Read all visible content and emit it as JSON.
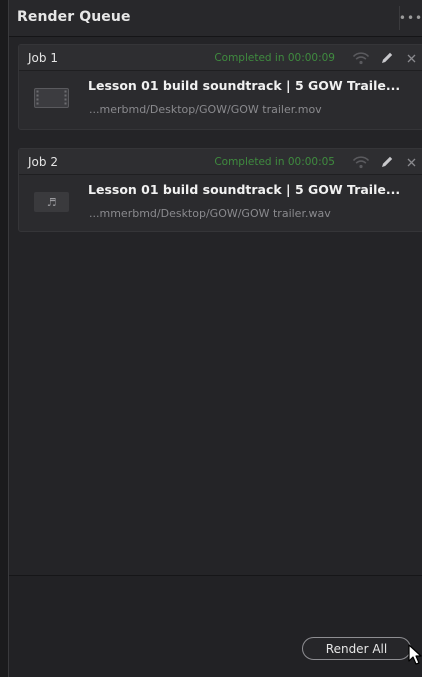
{
  "panel": {
    "title": "Render Queue",
    "more_icon": "more-horizontal-icon"
  },
  "jobs": [
    {
      "name": "Job 1",
      "status": "Completed in 00:00:09",
      "title": "Lesson 01 build soundtrack | 5 GOW Traile...",
      "path": "...merbmd/Desktop/GOW/GOW trailer.mov",
      "thumbnail": "video-file-icon"
    },
    {
      "name": "Job 2",
      "status": "Completed in 00:00:05",
      "title": "Lesson 01 build soundtrack | 5 GOW Traile...",
      "path": "...mmerbmd/Desktop/GOW/GOW trailer.wav",
      "thumbnail": "audio-file-icon"
    }
  ],
  "footer": {
    "render_all_label": "Render All"
  },
  "colors": {
    "status_green": "#3f8b3f",
    "panel_bg": "#242427",
    "job_bg": "#2b2b2e"
  }
}
